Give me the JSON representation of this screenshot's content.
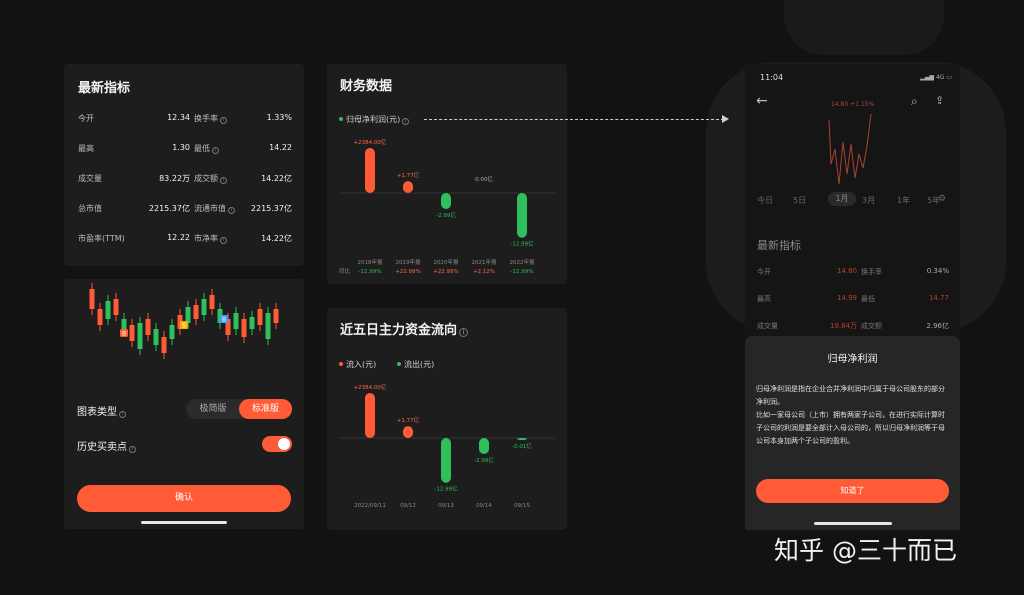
{
  "metrics": {
    "title": "最新指标",
    "rows": [
      {
        "l1": "今开",
        "v1": "12.34",
        "l2": "换手率",
        "v2": "1.33%"
      },
      {
        "l1": "最高",
        "v1": "1.30",
        "l2": "最低",
        "v2": "14.22"
      },
      {
        "l1": "成交量",
        "v1": "83.22万",
        "l2": "成交额",
        "v2": "14.22亿"
      },
      {
        "l1": "总市值",
        "v1": "2215.37亿",
        "l2": "流通市值",
        "v2": "2215.37亿"
      },
      {
        "l1": "市盈率(TTM)",
        "v1": "12.22",
        "l2": "市净率",
        "v2": "14.22亿"
      }
    ]
  },
  "settings": {
    "chart_type_label": "图表类型",
    "seg_simple": "极简版",
    "seg_standard": "标准版",
    "history_label": "历史买卖点",
    "confirm": "确认",
    "markers": [
      "B",
      "S",
      "B",
      "S"
    ]
  },
  "finance": {
    "title": "财务数据",
    "legend": "归母净利润(元)",
    "yoy_label": "同比",
    "chart_data": {
      "type": "bar",
      "categories": [
        "2018年报",
        "2019年报",
        "2020年报",
        "2021年报",
        "2022年报"
      ],
      "values": [
        2384.0,
        1.77,
        -2.99,
        0.0,
        -12.99
      ],
      "labels": [
        "+2384.00亿",
        "+1.77亿",
        "-2.99亿",
        "0.00亿",
        "-12.99亿"
      ],
      "yoy": [
        "-12.99%",
        "+22.99%",
        "+22.99%",
        "+2.12%",
        "-12.99%"
      ]
    }
  },
  "flow": {
    "title": "近五日主力资金流向",
    "legend_in": "流入(元)",
    "legend_out": "流出(元)",
    "chart_data": {
      "type": "bar",
      "categories": [
        "2022/09/11",
        "09/12",
        "09/13",
        "09/14",
        "09/15"
      ],
      "values": [
        2384.0,
        1.77,
        -12.99,
        -2.99,
        -0.01
      ],
      "labels": [
        "+2384.00亿",
        "+1.77亿",
        "-12.99亿",
        "-2.99亿",
        "-0.01亿"
      ]
    }
  },
  "phone": {
    "time": "11:04",
    "status": "4G",
    "price": "14.80  +1.15%",
    "tabs": [
      "今日",
      "5日",
      "1月",
      "3月",
      "1年",
      "5年"
    ],
    "metrics_title": "最新指标",
    "rows": [
      {
        "l1": "今开",
        "v1": "14.80",
        "l2": "换手率",
        "v2": "0.34%"
      },
      {
        "l1": "最高",
        "v1": "14.99",
        "l2": "最低",
        "v2": "14.77"
      },
      {
        "l1": "成交量",
        "v1": "19.84万",
        "l2": "成交额",
        "v2": "2.96亿"
      }
    ],
    "sheet_title": "归母净利润",
    "sheet_p1": "归母净利润是指在企业合并净利润中归属于母公司股东的部分净利润。",
    "sheet_p2": "比如一家母公司（上市）拥有两家子公司，在进行实际计算时子公司的利润是要全部计入母公司的，所以归母净利润等于母公司本身加两个子公司的盈利。",
    "sheet_button": "知道了"
  },
  "watermark": "知乎 @三十而已",
  "colors": {
    "accent": "#ff5b37",
    "up": "#ff5b37",
    "down": "#2fbf5c",
    "card": "#1d1d1d"
  }
}
